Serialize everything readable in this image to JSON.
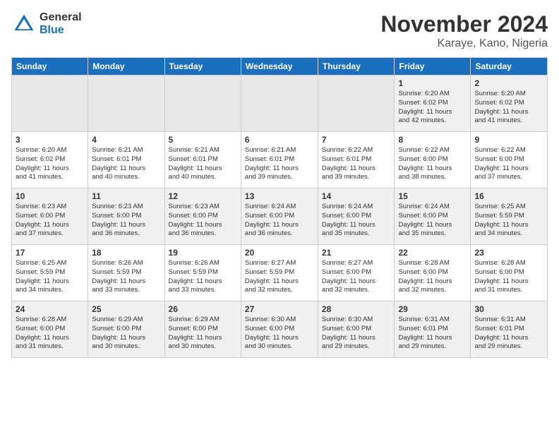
{
  "logo": {
    "general": "General",
    "blue": "Blue"
  },
  "title": "November 2024",
  "location": "Karaye, Kano, Nigeria",
  "weekdays": [
    "Sunday",
    "Monday",
    "Tuesday",
    "Wednesday",
    "Thursday",
    "Friday",
    "Saturday"
  ],
  "weeks": [
    [
      {
        "day": "",
        "info": ""
      },
      {
        "day": "",
        "info": ""
      },
      {
        "day": "",
        "info": ""
      },
      {
        "day": "",
        "info": ""
      },
      {
        "day": "",
        "info": ""
      },
      {
        "day": "1",
        "info": "Sunrise: 6:20 AM\nSunset: 6:02 PM\nDaylight: 11 hours\nand 42 minutes."
      },
      {
        "day": "2",
        "info": "Sunrise: 6:20 AM\nSunset: 6:02 PM\nDaylight: 11 hours\nand 41 minutes."
      }
    ],
    [
      {
        "day": "3",
        "info": "Sunrise: 6:20 AM\nSunset: 6:02 PM\nDaylight: 11 hours\nand 41 minutes."
      },
      {
        "day": "4",
        "info": "Sunrise: 6:21 AM\nSunset: 6:01 PM\nDaylight: 11 hours\nand 40 minutes."
      },
      {
        "day": "5",
        "info": "Sunrise: 6:21 AM\nSunset: 6:01 PM\nDaylight: 11 hours\nand 40 minutes."
      },
      {
        "day": "6",
        "info": "Sunrise: 6:21 AM\nSunset: 6:01 PM\nDaylight: 11 hours\nand 39 minutes."
      },
      {
        "day": "7",
        "info": "Sunrise: 6:22 AM\nSunset: 6:01 PM\nDaylight: 11 hours\nand 39 minutes."
      },
      {
        "day": "8",
        "info": "Sunrise: 6:22 AM\nSunset: 6:00 PM\nDaylight: 11 hours\nand 38 minutes."
      },
      {
        "day": "9",
        "info": "Sunrise: 6:22 AM\nSunset: 6:00 PM\nDaylight: 11 hours\nand 37 minutes."
      }
    ],
    [
      {
        "day": "10",
        "info": "Sunrise: 6:23 AM\nSunset: 6:00 PM\nDaylight: 11 hours\nand 37 minutes."
      },
      {
        "day": "11",
        "info": "Sunrise: 6:23 AM\nSunset: 6:00 PM\nDaylight: 11 hours\nand 36 minutes."
      },
      {
        "day": "12",
        "info": "Sunrise: 6:23 AM\nSunset: 6:00 PM\nDaylight: 11 hours\nand 36 minutes."
      },
      {
        "day": "13",
        "info": "Sunrise: 6:24 AM\nSunset: 6:00 PM\nDaylight: 11 hours\nand 36 minutes."
      },
      {
        "day": "14",
        "info": "Sunrise: 6:24 AM\nSunset: 6:00 PM\nDaylight: 11 hours\nand 35 minutes."
      },
      {
        "day": "15",
        "info": "Sunrise: 6:24 AM\nSunset: 6:00 PM\nDaylight: 11 hours\nand 35 minutes."
      },
      {
        "day": "16",
        "info": "Sunrise: 6:25 AM\nSunset: 5:59 PM\nDaylight: 11 hours\nand 34 minutes."
      }
    ],
    [
      {
        "day": "17",
        "info": "Sunrise: 6:25 AM\nSunset: 5:59 PM\nDaylight: 11 hours\nand 34 minutes."
      },
      {
        "day": "18",
        "info": "Sunrise: 6:26 AM\nSunset: 5:59 PM\nDaylight: 11 hours\nand 33 minutes."
      },
      {
        "day": "19",
        "info": "Sunrise: 6:26 AM\nSunset: 5:59 PM\nDaylight: 11 hours\nand 33 minutes."
      },
      {
        "day": "20",
        "info": "Sunrise: 6:27 AM\nSunset: 5:59 PM\nDaylight: 11 hours\nand 32 minutes."
      },
      {
        "day": "21",
        "info": "Sunrise: 6:27 AM\nSunset: 6:00 PM\nDaylight: 11 hours\nand 32 minutes."
      },
      {
        "day": "22",
        "info": "Sunrise: 6:28 AM\nSunset: 6:00 PM\nDaylight: 11 hours\nand 32 minutes."
      },
      {
        "day": "23",
        "info": "Sunrise: 6:28 AM\nSunset: 6:00 PM\nDaylight: 11 hours\nand 31 minutes."
      }
    ],
    [
      {
        "day": "24",
        "info": "Sunrise: 6:28 AM\nSunset: 6:00 PM\nDaylight: 11 hours\nand 31 minutes."
      },
      {
        "day": "25",
        "info": "Sunrise: 6:29 AM\nSunset: 6:00 PM\nDaylight: 11 hours\nand 30 minutes."
      },
      {
        "day": "26",
        "info": "Sunrise: 6:29 AM\nSunset: 6:00 PM\nDaylight: 11 hours\nand 30 minutes."
      },
      {
        "day": "27",
        "info": "Sunrise: 6:30 AM\nSunset: 6:00 PM\nDaylight: 11 hours\nand 30 minutes."
      },
      {
        "day": "28",
        "info": "Sunrise: 6:30 AM\nSunset: 6:00 PM\nDaylight: 11 hours\nand 29 minutes."
      },
      {
        "day": "29",
        "info": "Sunrise: 6:31 AM\nSunset: 6:01 PM\nDaylight: 11 hours\nand 29 minutes."
      },
      {
        "day": "30",
        "info": "Sunrise: 6:31 AM\nSunset: 6:01 PM\nDaylight: 11 hours\nand 29 minutes."
      }
    ]
  ]
}
